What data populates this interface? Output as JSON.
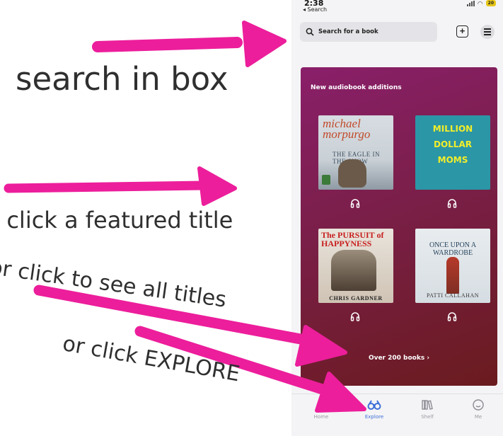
{
  "status_bar": {
    "time": "2:38",
    "back_label": "◂ Search",
    "battery": "20"
  },
  "search": {
    "placeholder": "Search for a book"
  },
  "header_buttons": {
    "add_symbol": "+"
  },
  "featured": {
    "title": "New audiobook additions",
    "see_all_label": "Over 200 books  ›",
    "books": [
      {
        "cover_author": "michael morpurgo",
        "cover_title": "THE EAGLE IN THE SNOW"
      },
      {
        "cover_lines": [
          "MILLION",
          "DOLLAR",
          "MOMS"
        ]
      },
      {
        "cover_title": "The PURSUIT of HAPPYNESS",
        "cover_author": "CHRIS GARDNER"
      },
      {
        "cover_title": "ONCE UPON A WARDROBE",
        "cover_author": "PATTI CALLAHAN"
      }
    ]
  },
  "tabs": [
    {
      "label": "Home",
      "icon": "home-icon",
      "active": false
    },
    {
      "label": "Explore",
      "icon": "binoculars-icon",
      "active": true
    },
    {
      "label": "Shelf",
      "icon": "bookshelf-icon",
      "active": false
    },
    {
      "label": "Me",
      "icon": "smiley-icon",
      "active": false
    }
  ],
  "annotations": {
    "search": "search in box",
    "featured": "r click a featured title",
    "all_titles": "or click to see all titles",
    "explore": "or click EXPLORE"
  },
  "colors": {
    "arrow": "#ec1e9b",
    "accent_blue": "#3d6fd8",
    "card_top": "#8a1f6a",
    "card_bottom": "#6a1b1e"
  }
}
